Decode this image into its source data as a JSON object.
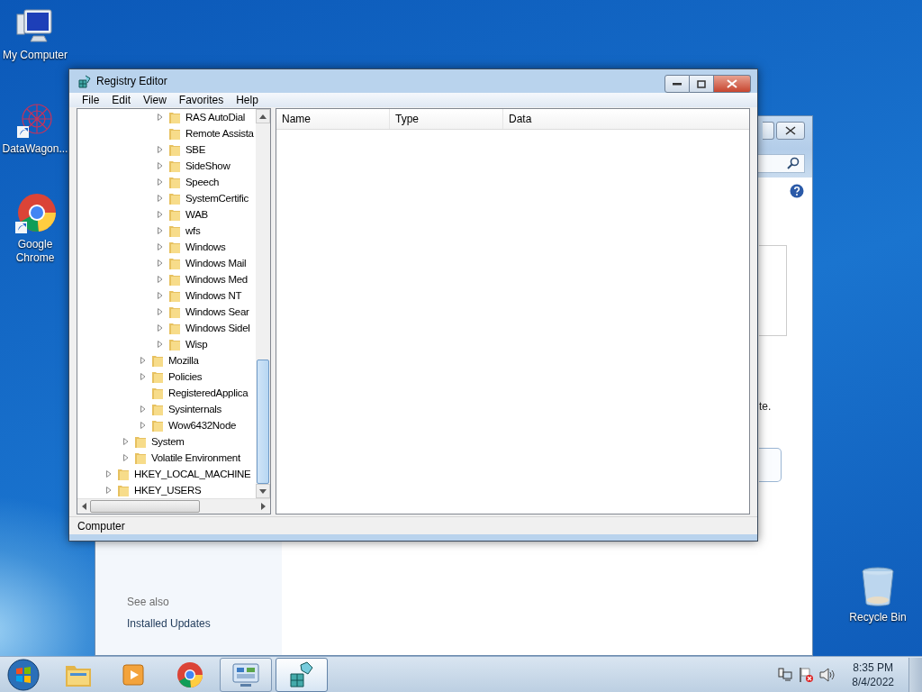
{
  "desktop_icons": [
    {
      "label": "My Computer",
      "kind": "computer"
    },
    {
      "label": "DataWagon...",
      "kind": "network"
    },
    {
      "label": "Google Chrome",
      "kind": "chrome"
    },
    {
      "label": "Recycle Bin",
      "kind": "bin"
    }
  ],
  "background_window": {
    "text_fragment": "te.",
    "see_also": "See also",
    "links": [
      "Installed Updates"
    ]
  },
  "window": {
    "title": "Registry Editor",
    "menu": [
      "File",
      "Edit",
      "View",
      "Favorites",
      "Help"
    ],
    "tree": [
      {
        "children": [
          {
            "children": [
              {
                "children": [
                  {
                    "label": "RAS AutoDial",
                    "has_children": true
                  },
                  {
                    "label": "Remote Assista",
                    "has_children": false
                  },
                  {
                    "label": "SBE",
                    "has_children": true
                  },
                  {
                    "label": "SideShow",
                    "has_children": true
                  },
                  {
                    "label": "Speech",
                    "has_children": true
                  },
                  {
                    "label": "SystemCertific",
                    "has_children": true
                  },
                  {
                    "label": "WAB",
                    "has_children": true
                  },
                  {
                    "label": "wfs",
                    "has_children": true
                  },
                  {
                    "label": "Windows",
                    "has_children": true
                  },
                  {
                    "label": "Windows Mail",
                    "has_children": true
                  },
                  {
                    "label": "Windows Med",
                    "has_children": true
                  },
                  {
                    "label": "Windows NT",
                    "has_children": true
                  },
                  {
                    "label": "Windows Sear",
                    "has_children": true
                  },
                  {
                    "label": "Windows Sidel",
                    "has_children": true
                  },
                  {
                    "label": "Wisp",
                    "has_children": true
                  }
                ]
              },
              {
                "label": "Mozilla",
                "has_children": true
              },
              {
                "label": "Policies",
                "has_children": true
              },
              {
                "label": "RegisteredApplica",
                "has_children": false
              },
              {
                "label": "Sysinternals",
                "has_children": true
              },
              {
                "label": "Wow6432Node",
                "has_children": true
              }
            ]
          },
          {
            "label": "System",
            "has_children": true
          },
          {
            "label": "Volatile Environment",
            "has_children": true
          }
        ]
      },
      {
        "label": "HKEY_LOCAL_MACHINE",
        "has_children": true
      },
      {
        "label": "HKEY_USERS",
        "has_children": true
      }
    ],
    "columns": [
      "Name",
      "Type",
      "Data"
    ],
    "status_bar": "Computer"
  },
  "taskbar": {
    "items": [
      {
        "kind": "explorer",
        "running": false,
        "selected": false
      },
      {
        "kind": "media",
        "running": false,
        "selected": false
      },
      {
        "kind": "chrome",
        "running": false,
        "selected": false
      },
      {
        "kind": "control",
        "running": true,
        "selected": false
      },
      {
        "kind": "regedit",
        "running": true,
        "selected": true
      }
    ],
    "time": "8:35 PM",
    "date": "8/4/2022"
  }
}
